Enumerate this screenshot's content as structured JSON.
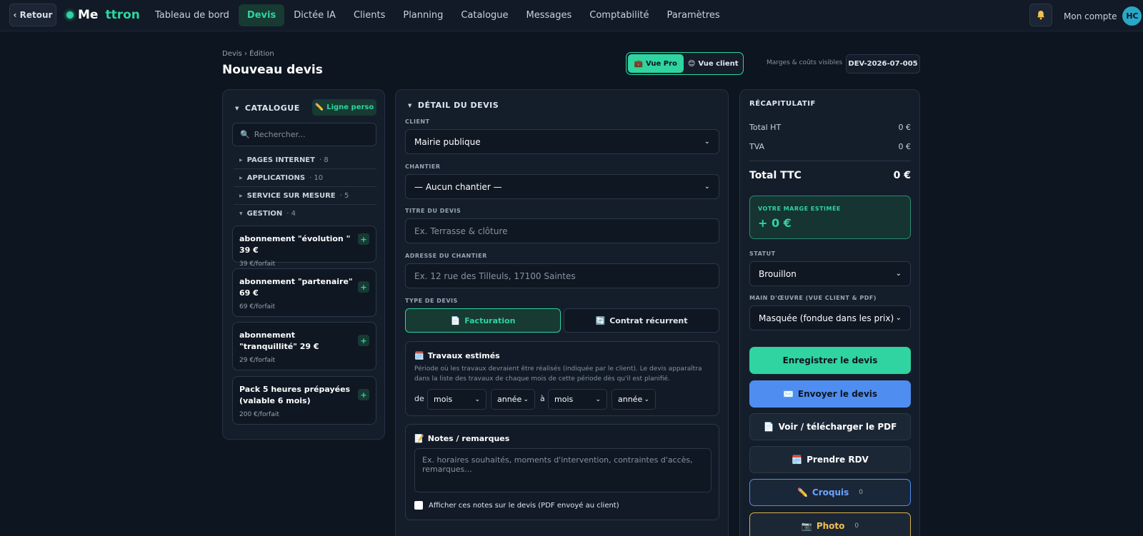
{
  "nav": {
    "back_label": "‹ Retour",
    "brand_part1": "Me",
    "brand_part2": "ttron",
    "items": [
      {
        "label": "Tableau de bord"
      },
      {
        "label": "Devis"
      },
      {
        "label": "Dictée IA"
      },
      {
        "label": "Clients"
      },
      {
        "label": "Planning"
      },
      {
        "label": "Catalogue"
      },
      {
        "label": "Messages"
      },
      {
        "label": "Comptabilité"
      },
      {
        "label": "Paramètres"
      }
    ],
    "active_item": "Devis",
    "account_label": "Mon compte",
    "avatar_initials": "HC"
  },
  "header": {
    "breadcrumb": "Devis › Édition",
    "title": "Nouveau devis",
    "view_pro": "Vue Pro",
    "view_client": "Vue client",
    "margin_note": "Marges & coûts visibles",
    "reference": "DEV-2026-07-005"
  },
  "catalogue": {
    "title": "CATALOGUE",
    "custom_line_label": "Ligne perso",
    "search_placeholder": "Rechercher...",
    "categories": [
      {
        "name": "PAGES INTERNET",
        "count": "· 8"
      },
      {
        "name": "APPLICATIONS",
        "count": "· 10"
      },
      {
        "name": "SERVICE SUR MESURE",
        "count": "· 5"
      },
      {
        "name": "GESTION",
        "count": "· 4"
      }
    ],
    "items": [
      {
        "name": "abonnement \"évolution \" 39 €",
        "price": "39 €/forfait"
      },
      {
        "name": "abonnement \"partenaire\" 69 €",
        "price": "69 €/forfait"
      },
      {
        "name": "abonnement \"tranquillité\" 29 €",
        "price": "29 €/forfait"
      },
      {
        "name": "Pack 5 heures prépayées (valable 6 mois)",
        "price": "200 €/forfait"
      }
    ],
    "add_symbol": "+"
  },
  "detail": {
    "title": "DÉTAIL DU DEVIS",
    "client_label": "CLIENT",
    "client_value": "Mairie publique",
    "chantier_label": "CHANTIER",
    "chantier_value": "— Aucun chantier —",
    "titre_label": "TITRE DU DEVIS",
    "titre_placeholder": "Ex. Terrasse & clôture",
    "adresse_label": "ADRESSE DU CHANTIER",
    "adresse_placeholder": "Ex. 12 rue des Tilleuls, 17100 Saintes",
    "type_label": "TYPE DE DEVIS",
    "type_facturation": "Facturation",
    "type_contrat": "Contrat récurrent",
    "travaux_title": "Travaux estimés",
    "travaux_desc": "Période où les travaux devraient être réalisés (indiquée par le client). Le devis apparaîtra dans la liste des travaux de chaque mois de cette période dès qu'il est planifié.",
    "de_label": "de",
    "a_label": "à",
    "mois_label": "mois",
    "annee_label": "année",
    "notes_title": "Notes / remarques",
    "notes_placeholder": "Ex. horaires souhaités, moments d'intervention, contraintes d'accès, remarques...",
    "notes_checkbox_label": "Afficher ces notes sur le devis (PDF envoyé au client)"
  },
  "summary": {
    "title": "RÉCAPITULATIF",
    "total_ht_label": "Total HT",
    "total_ht_value": "0 €",
    "tva_label": "TVA",
    "tva_value": "0 €",
    "total_ttc_label": "Total TTC",
    "total_ttc_value": "0 €",
    "marge_label": "VOTRE MARGE ESTIMÉE",
    "marge_value": "+ 0 €",
    "statut_label": "STATUT",
    "statut_value": "Brouillon",
    "main_oeuvre_label": "MAIN D'ŒUVRE (VUE CLIENT & PDF)",
    "main_oeuvre_value": "Masquée (fondue dans les prix)",
    "save_label": "Enregistrer le devis",
    "send_label": "Envoyer le devis",
    "pdf_label": "Voir / télécharger le PDF",
    "rdv_label": "Prendre RDV",
    "croquis_label": "Croquis",
    "croquis_count": "0",
    "photo_label": "Photo",
    "photo_count": "0"
  },
  "colors": {
    "accent": "#2fd4a0",
    "blue": "#4f8ef0",
    "yellow": "#f2c14e",
    "background": "#0d1520"
  }
}
